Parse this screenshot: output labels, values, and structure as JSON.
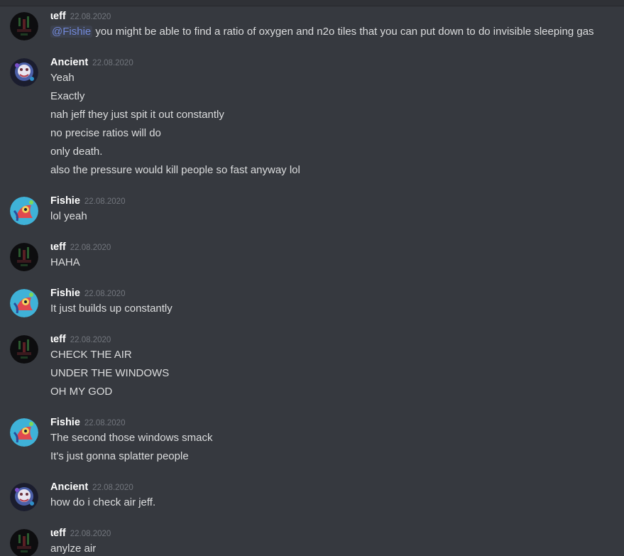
{
  "channel": {
    "messages": [
      {
        "author": "ɩeff",
        "avatar": "jeff-avatar-icon",
        "timestamp": "22.08.2020",
        "mention": "@Fishie",
        "lines": [
          "you might be able to find a ratio of oxygen and n2o tiles that you can put down to do invisible sleeping gas"
        ]
      },
      {
        "author": "Ancient",
        "avatar": "ancient-avatar-icon",
        "timestamp": "22.08.2020",
        "lines": [
          "Yeah",
          "Exactly",
          "nah jeff they just spit it out constantly",
          "no precise ratios will do",
          "only death.",
          "also the pressure would kill people so fast anyway lol"
        ]
      },
      {
        "author": "Fishie",
        "avatar": "fishie-avatar-icon",
        "timestamp": "22.08.2020",
        "lines": [
          "lol yeah"
        ]
      },
      {
        "author": "ɩeff",
        "avatar": "jeff-avatar-icon",
        "timestamp": "22.08.2020",
        "lines": [
          "HAHA"
        ]
      },
      {
        "author": "Fishie",
        "avatar": "fishie-avatar-icon",
        "timestamp": "22.08.2020",
        "lines": [
          "It just builds up constantly"
        ]
      },
      {
        "author": "ɩeff",
        "avatar": "jeff-avatar-icon",
        "timestamp": "22.08.2020",
        "lines": [
          "CHECK THE AIR",
          "UNDER THE WINDOWS",
          "OH MY GOD"
        ]
      },
      {
        "author": "Fishie",
        "avatar": "fishie-avatar-icon",
        "timestamp": "22.08.2020",
        "lines": [
          "The second those windows smack",
          "It's just gonna splatter people"
        ]
      },
      {
        "author": "Ancient",
        "avatar": "ancient-avatar-icon",
        "timestamp": "22.08.2020",
        "lines": [
          "how do i check air jeff."
        ]
      },
      {
        "author": "ɩeff",
        "avatar": "jeff-avatar-icon",
        "timestamp": "22.08.2020",
        "lines": [
          "anylze air"
        ]
      }
    ]
  },
  "colors": {
    "background": "#36393f",
    "username": "#ffffff",
    "message_text": "#dcddde",
    "timestamp": "#72767d",
    "mention": "#7289da"
  }
}
